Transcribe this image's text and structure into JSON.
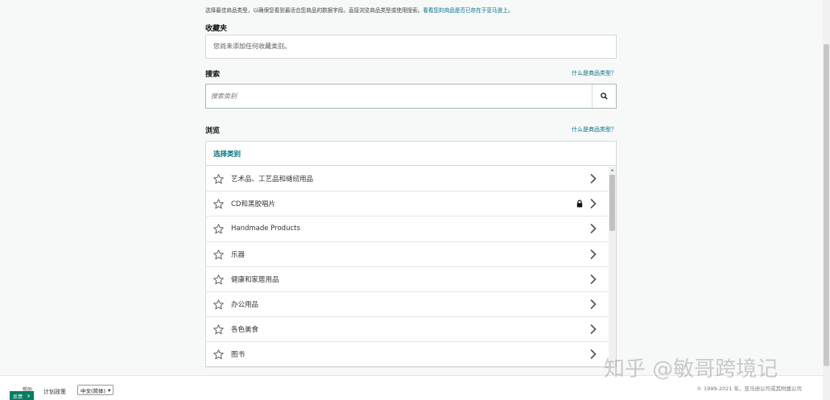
{
  "intro": {
    "text": "选择最佳商品类型，以确保您看到最适合您商品的数据字段。直接浏览商品类型或使用搜索。",
    "link": "看看您的商品是否已存在于亚马逊上。"
  },
  "favorites": {
    "title": "收藏夹",
    "empty_text": "您尚未添加任何收藏类别。"
  },
  "search": {
    "title": "搜索",
    "help_link": "什么是商品类型？",
    "placeholder": "搜索类别"
  },
  "browse": {
    "title": "浏览",
    "help_link": "什么是商品类型？",
    "header": "选择类别",
    "categories": [
      {
        "label": "艺术品、工艺品和缝纫用品",
        "locked": false
      },
      {
        "label": "CD和黑胶唱片",
        "locked": true
      },
      {
        "label": "Handmade Products",
        "locked": false
      },
      {
        "label": "乐器",
        "locked": false
      },
      {
        "label": "健康和家居用品",
        "locked": false
      },
      {
        "label": "办公用品",
        "locked": false
      },
      {
        "label": "各色美食",
        "locked": false
      },
      {
        "label": "图书",
        "locked": false
      }
    ]
  },
  "footer": {
    "feedback": "反馈",
    "feedback_close": "×",
    "help": "帮助",
    "policy": "计划政策",
    "language": "中文(简体)",
    "copyright": "© 1999-2021 年，亚马逊公司或其附属公司"
  },
  "watermark": "知乎 @敏哥跨境记",
  "colors": {
    "link": "#007185",
    "feedback_bg": "#067d62"
  }
}
